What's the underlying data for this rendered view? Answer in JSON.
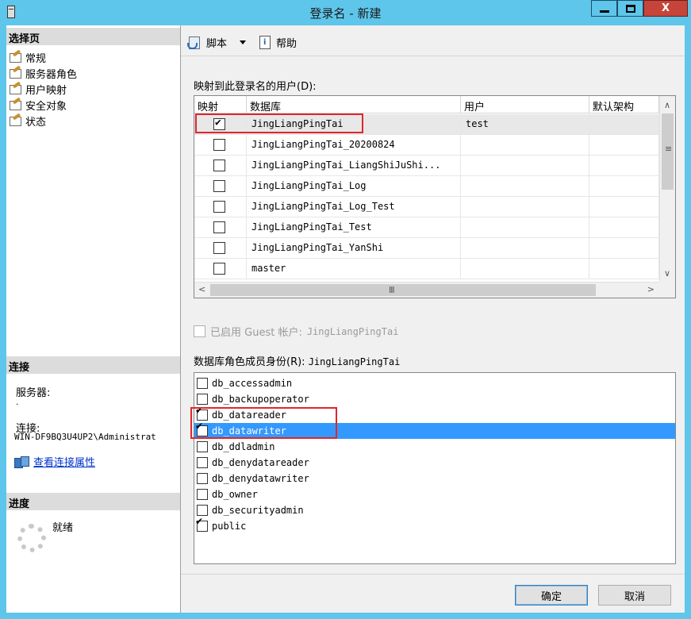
{
  "window": {
    "title": "登录名 - 新建"
  },
  "left": {
    "select_page_header": "选择页",
    "nav_items": [
      "常规",
      "服务器角色",
      "用户映射",
      "安全对象",
      "状态"
    ],
    "connection_header": "连接",
    "server_label": "服务器:",
    "server_value": ".",
    "connection_label": "连接:",
    "connection_value": "WIN-DF9BQ3U4UP2\\Administrat",
    "view_props_link": "查看连接属性",
    "progress_header": "进度",
    "progress_status": "就绪"
  },
  "toolbar": {
    "script_label": "脚本",
    "help_label": "帮助"
  },
  "mapping": {
    "label": "映射到此登录名的用户(D):",
    "columns": [
      "映射",
      "数据库",
      "用户",
      "默认架构"
    ],
    "rows": [
      {
        "checked": true,
        "database": "JingLiangPingTai",
        "user": "test",
        "schema": ""
      },
      {
        "checked": false,
        "database": "JingLiangPingTai_20200824",
        "user": "",
        "schema": ""
      },
      {
        "checked": false,
        "database": "JingLiangPingTai_LiangShiJuShi...",
        "user": "",
        "schema": ""
      },
      {
        "checked": false,
        "database": "JingLiangPingTai_Log",
        "user": "",
        "schema": ""
      },
      {
        "checked": false,
        "database": "JingLiangPingTai_Log_Test",
        "user": "",
        "schema": ""
      },
      {
        "checked": false,
        "database": "JingLiangPingTai_Test",
        "user": "",
        "schema": ""
      },
      {
        "checked": false,
        "database": "JingLiangPingTai_YanShi",
        "user": "",
        "schema": ""
      },
      {
        "checked": false,
        "database": "master",
        "user": "",
        "schema": ""
      }
    ]
  },
  "guest": {
    "label": "已启用 Guest 帐户:",
    "db": "JingLiangPingTai"
  },
  "roles": {
    "label": "数据库角色成员身份(R):",
    "db": "JingLiangPingTai",
    "items": [
      {
        "name": "db_accessadmin",
        "checked": false
      },
      {
        "name": "db_backupoperator",
        "checked": false
      },
      {
        "name": "db_datareader",
        "checked": true
      },
      {
        "name": "db_datawriter",
        "checked": true
      },
      {
        "name": "db_ddladmin",
        "checked": false
      },
      {
        "name": "db_denydatareader",
        "checked": false
      },
      {
        "name": "db_denydatawriter",
        "checked": false
      },
      {
        "name": "db_owner",
        "checked": false
      },
      {
        "name": "db_securityadmin",
        "checked": false
      },
      {
        "name": "public",
        "checked": true
      }
    ]
  },
  "buttons": {
    "ok": "确定",
    "cancel": "取消"
  },
  "colors": {
    "title_bar": "#5ec6ea",
    "highlight": "#3399ff",
    "annotation": "#e0262b",
    "close": "#c7443a"
  }
}
